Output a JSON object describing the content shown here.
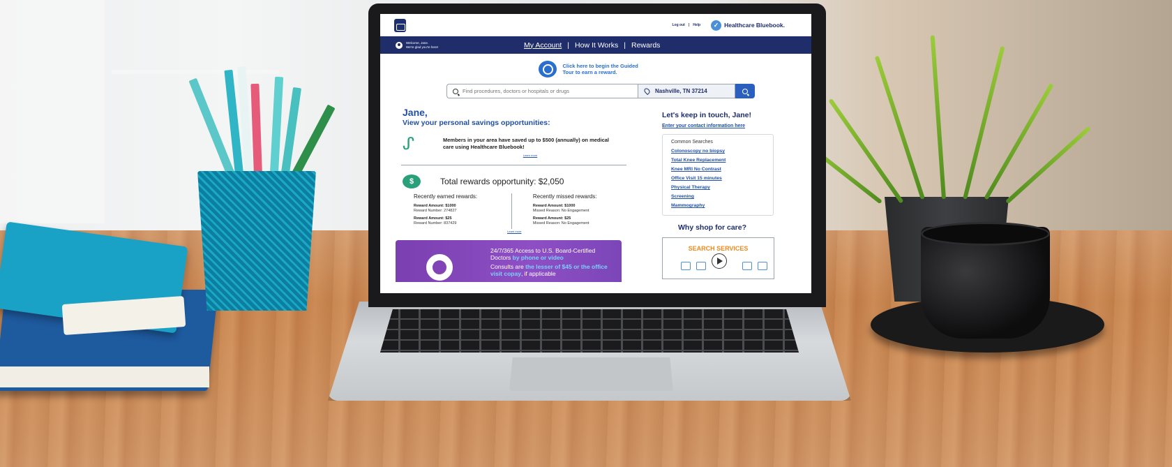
{
  "header": {
    "log_out": "Log out",
    "separator": "|",
    "help": "Help",
    "brand_name": "Healthcare Bluebook."
  },
  "nav": {
    "welcome_line1": "Welcome, Jane.",
    "welcome_line2": "We're glad you're here!",
    "items": [
      {
        "label": "My Account",
        "active": true
      },
      {
        "label": "How It Works",
        "active": false
      },
      {
        "label": "Rewards",
        "active": false
      }
    ],
    "separator": "|"
  },
  "tour": {
    "line1": "Click here to begin the Guided",
    "line2": "Tour to earn a reward."
  },
  "search": {
    "placeholder": "Find procedures, doctors or hospitals or drugs",
    "location": "Nashville, TN 37214"
  },
  "savings": {
    "greeting": "Jane,",
    "subtitle": "View your personal savings opportunities:",
    "member_text": "Members in your area have saved up to $500 (annually) on medical care using Healthcare Bluebook!",
    "learn_more": "Learn more"
  },
  "rewards": {
    "badge": "$",
    "total": "Total rewards opportunity: $2,050",
    "earned_title": "Recently earned rewards:",
    "missed_title": "Recently missed rewards:",
    "earned": [
      {
        "amount": "Reward Amount: $1000",
        "detail": "Reward Number: 274827"
      },
      {
        "amount": "Reward Amount: $25",
        "detail": "Reward Number: 837429"
      }
    ],
    "missed": [
      {
        "amount": "Reward Amount: $1000",
        "detail": "Missed Reason: No Engagement"
      },
      {
        "amount": "Reward Amount: $25",
        "detail": "Missed Reason: No Engagement"
      }
    ],
    "learn_more": "Learn more"
  },
  "promo": {
    "line1_a": "24/7/365 Access to U.S. Board-Certified Doctors ",
    "line1_b": "by phone or video",
    "line2_a": "Consults are ",
    "line2_b": "the lesser of $45 or the office visit copay",
    "line2_c": ", if applicable"
  },
  "contact": {
    "title": "Let's keep in touch, Jane!",
    "link": "Enter your contact information here"
  },
  "common_searches": {
    "title": "Common Searches",
    "items": [
      "Colonoscopy no biopsy",
      "Total Knee Replacement",
      "Knee MRI No Contrast",
      "Office Visit 15 minutes",
      "Physical Therapy",
      "Screening",
      "Mammography"
    ]
  },
  "why_shop": {
    "title": "Why shop for care?",
    "video_title": "SEARCH SERVICES"
  },
  "colors": {
    "navy": "#1f2d6b",
    "link_blue": "#1f4fa6",
    "accent_green": "#2aa07a",
    "promo_purple": "#7a3fb0",
    "orange": "#f08a1c"
  }
}
